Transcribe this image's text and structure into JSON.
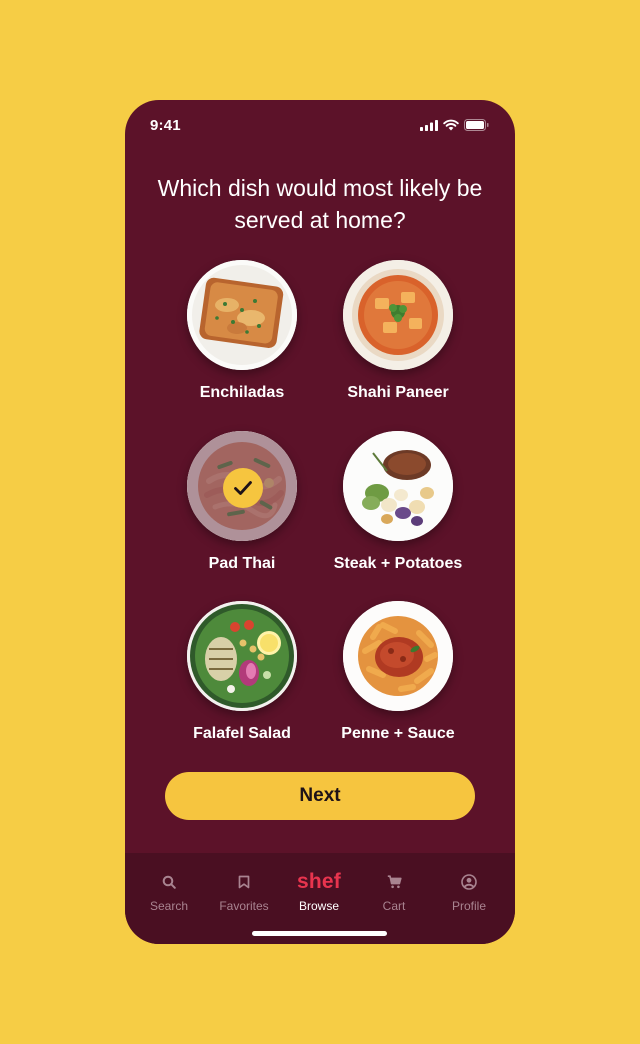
{
  "status": {
    "time": "9:41"
  },
  "question": "Which dish would most likely be served at home?",
  "dishes": [
    {
      "label": "Enchiladas",
      "selected": false
    },
    {
      "label": "Shahi Paneer",
      "selected": false
    },
    {
      "label": "Pad Thai",
      "selected": true
    },
    {
      "label": "Steak + Potatoes",
      "selected": false
    },
    {
      "label": "Falafel Salad",
      "selected": false
    },
    {
      "label": "Penne + Sauce",
      "selected": false
    }
  ],
  "next_label": "Next",
  "tabs": [
    {
      "label": "Search",
      "icon": "search-icon"
    },
    {
      "label": "Favorites",
      "icon": "bookmark-icon"
    },
    {
      "label": "Browse",
      "icon": "shef-logo",
      "brand": "shef",
      "active": true
    },
    {
      "label": "Cart",
      "icon": "cart-icon"
    },
    {
      "label": "Profile",
      "icon": "profile-icon"
    }
  ],
  "colors": {
    "background": "#f6cd45",
    "panel": "#5c1229",
    "accent": "#f6c53f",
    "brand": "#e8344e"
  }
}
